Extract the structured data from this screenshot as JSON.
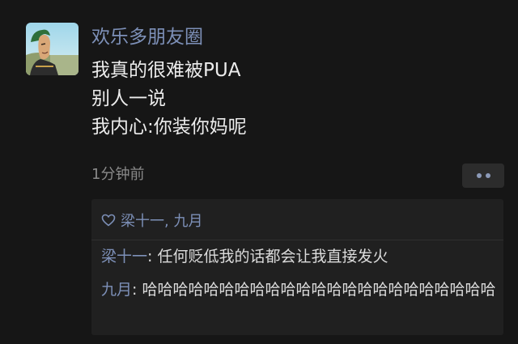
{
  "post": {
    "author": "欢乐多朋友圈",
    "lines": [
      "我真的很难被PUA",
      "别人一说",
      "我内心:你装你妈呢"
    ],
    "time": "1分钟前"
  },
  "likes": {
    "names": "梁十一, 九月",
    "icon": "heart-outline-icon"
  },
  "comments": [
    {
      "commenter": "梁十一",
      "separator": ": ",
      "text": "任何贬低我的话都会让我直接发火"
    },
    {
      "commenter": "九月",
      "separator": ": ",
      "text": "哈哈哈哈哈哈哈哈哈哈哈哈哈哈哈哈哈哈哈哈哈哈哈"
    }
  ],
  "colors": {
    "background": "#161616",
    "name_link": "#7d90b8",
    "comment_panel": "#202020"
  }
}
